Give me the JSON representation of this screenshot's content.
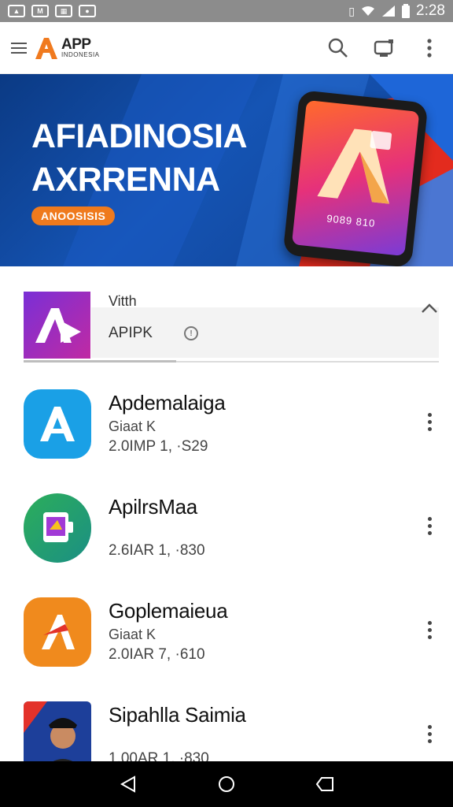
{
  "status_bar": {
    "time": "2:28",
    "notification_icons": [
      "image-icon",
      "gmail-icon",
      "news-icon",
      "camera-icon"
    ],
    "system_icons": [
      "vibrate-icon",
      "wifi-icon",
      "signal-icon",
      "battery-icon"
    ]
  },
  "app_bar": {
    "logo_title": "APP",
    "logo_subtitle": "INDONESIA",
    "actions": [
      "search-icon",
      "cast-icon",
      "more-vert-icon"
    ]
  },
  "banner": {
    "title_line1": "AFIADINOSIA",
    "title_line2": "AXRRENNA",
    "pill": "ANOOSISIS",
    "phone_code": "9089 810",
    "colors": {
      "background": "#0f4aa5",
      "accent": "#ef7a1d",
      "red": "#e32b1e"
    }
  },
  "featured": {
    "label": "Vitth",
    "name": "APIPK",
    "icon": "info-icon"
  },
  "apps": [
    {
      "title": "Apdemalaiga",
      "subtitle": "Giaat K",
      "meta": "2.0IMP 1, ·S29",
      "icon_color": "#1aa0e6"
    },
    {
      "title": "ApilrsMaa",
      "subtitle": "",
      "meta": "2.6IAR 1, ·830",
      "icon_color": "#2cae5a"
    },
    {
      "title": "Goplemaieua",
      "subtitle": "Giaat K",
      "meta": "2.0IAR 7, ·610",
      "icon_color": "#f08a1d"
    },
    {
      "title": "Sipahlla Saimia",
      "subtitle": "",
      "meta": "1.00AR 1, ·830",
      "icon_color": "#1d3f9a"
    }
  ],
  "nav_bar": [
    "back-icon",
    "home-icon",
    "recents-icon"
  ]
}
